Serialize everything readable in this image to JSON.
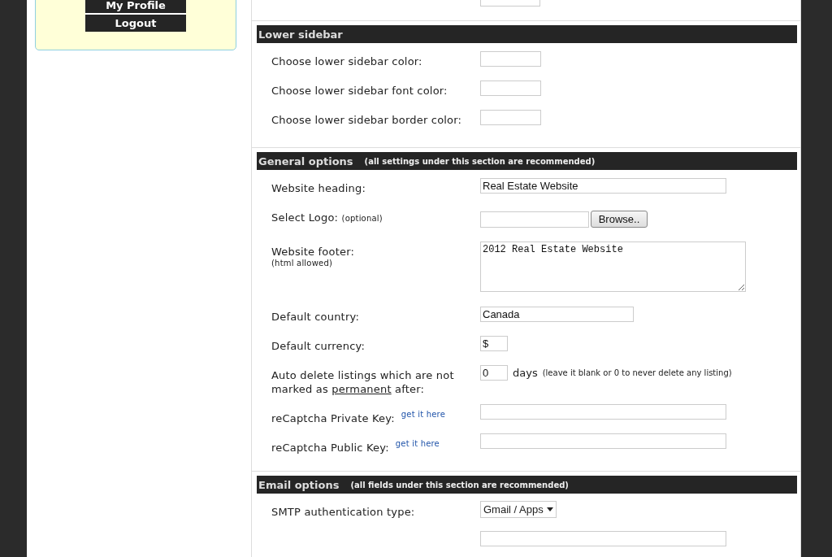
{
  "sidebar": {
    "buttons": [
      "My Profile",
      "Logout"
    ]
  },
  "sections": [
    {
      "title": "Lower sidebar",
      "rows": [
        {
          "kind": "color",
          "label": "Choose lower sidebar color:",
          "value": ""
        },
        {
          "kind": "color",
          "label": "Choose lower sidebar font color:",
          "value": ""
        },
        {
          "kind": "color",
          "label": "Choose lower sidebar border color:",
          "value": ""
        }
      ]
    },
    {
      "title": "General options",
      "note": "(all settings under this section are recommended)",
      "rows": [
        {
          "kind": "wide",
          "label": "Website heading:",
          "value": "Real Estate Website"
        },
        {
          "kind": "file",
          "label": "Select Logo:",
          "inline_note": "(optional)",
          "button": "Browse.."
        },
        {
          "kind": "textarea",
          "label": "Website footer:",
          "sub_note": "(html allowed)",
          "value": "2012 Real Estate Website"
        },
        {
          "kind": "medium",
          "label": "Default country:",
          "value": "Canada"
        },
        {
          "kind": "tiny",
          "label": "Default currency:",
          "value": "$"
        },
        {
          "kind": "days",
          "label": "Auto delete listings which are not marked as",
          "underlined": "permanent",
          "label_after": "after:",
          "value": "0",
          "suffix": "days",
          "suffix_note": "(leave it blank or 0 to never delete any listing)"
        },
        {
          "kind": "wide",
          "label": "reCaptcha Private Key:",
          "link": "get it here",
          "value": ""
        },
        {
          "kind": "wide",
          "label": "reCaptcha Public Key:",
          "link": "get it here",
          "value": ""
        }
      ]
    },
    {
      "title": "Email options",
      "note": "(all fields under this section are recommended)",
      "rows": [
        {
          "kind": "select",
          "label": "SMTP authentication type:",
          "value": "Gmail / Apps"
        },
        {
          "kind": "wide",
          "label": "",
          "value": ""
        }
      ]
    }
  ]
}
